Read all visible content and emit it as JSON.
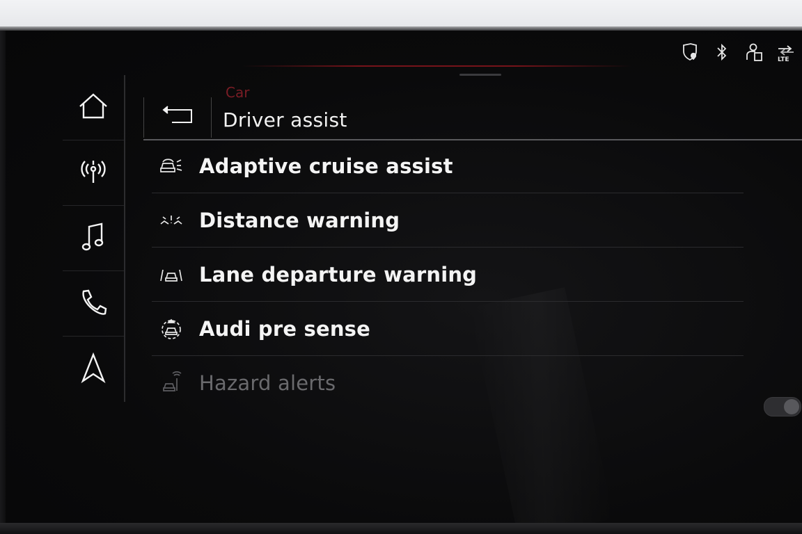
{
  "status_bar": {
    "icons": [
      "location-shield-icon",
      "bluetooth-icon",
      "user-profile-icon",
      "lte-signal-icon"
    ],
    "lte_label": "LTE"
  },
  "sidebar": {
    "items": [
      {
        "icon": "home-icon"
      },
      {
        "icon": "radio-antenna-icon"
      },
      {
        "icon": "music-note-icon"
      },
      {
        "icon": "phone-icon"
      },
      {
        "icon": "navigation-icon"
      }
    ]
  },
  "header": {
    "breadcrumb": "Car",
    "title": "Driver assist"
  },
  "menu": {
    "items": [
      {
        "label": "Adaptive cruise assist",
        "icon": "adaptive-cruise-icon",
        "enabled": true
      },
      {
        "label": "Distance warning",
        "icon": "distance-warning-icon",
        "enabled": true
      },
      {
        "label": "Lane departure warning",
        "icon": "lane-departure-icon",
        "enabled": true
      },
      {
        "label": "Audi pre sense",
        "icon": "pre-sense-icon",
        "enabled": true
      },
      {
        "label": "Hazard alerts",
        "icon": "hazard-alerts-icon",
        "enabled": false,
        "toggle": "on"
      }
    ]
  },
  "colors": {
    "background": "#0b0b0c",
    "text": "#f4f4f4",
    "disabled_text": "#6a6a6d",
    "accent_red": "#7a1d25"
  }
}
